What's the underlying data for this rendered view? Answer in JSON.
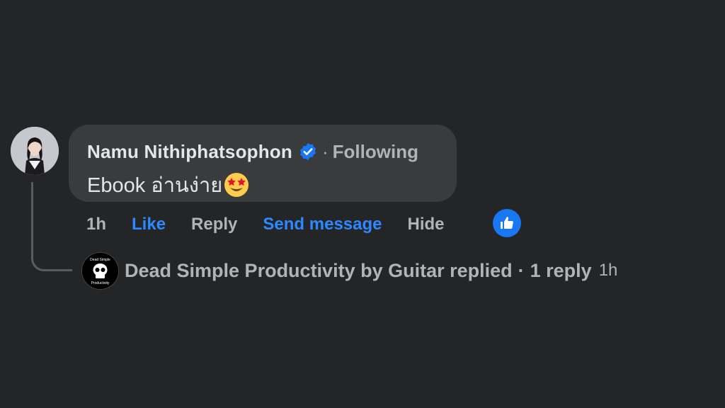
{
  "comment": {
    "author": "Namu Nithiphatsophon",
    "separator": "·",
    "following_label": "Following",
    "text": "Ebook อ่านง่าย",
    "emoji": "star-struck-emoji"
  },
  "actions": {
    "time": "1h",
    "like": "Like",
    "reply": "Reply",
    "send_message": "Send message",
    "hide": "Hide"
  },
  "reply_summary": {
    "text": "Dead Simple Productivity by Guitar replied",
    "separator": "·",
    "count": "1 reply",
    "time": "1h",
    "avatar_text": [
      "Dead Simple",
      "Productivity"
    ]
  },
  "colors": {
    "background": "#242526",
    "bubble": "#3a3b3c",
    "accent": "#2d88ff",
    "verified": "#1877f2"
  }
}
